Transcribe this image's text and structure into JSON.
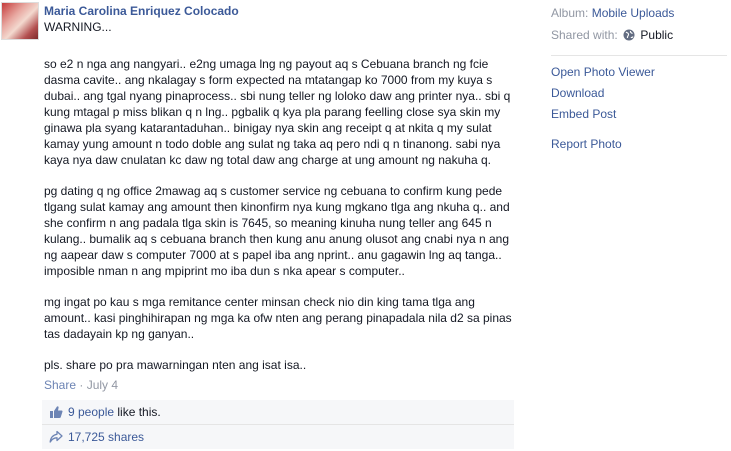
{
  "post": {
    "author": "Maria Carolina Enriquez Colocado",
    "headline": "WARNING...",
    "paragraphs": [
      "so e2 n nga ang nangyari.. e2ng umaga lng ng payout aq s Cebuana branch ng fcie dasma cavite.. ang nkalagay s form expected na mtatangap ko 7000 from my kuya s dubai.. ang tgal nyang pinaprocess.. sbi nung teller ng loloko daw ang printer nya.. sbi q kung mtagal p miss blikan q n lng.. pgbalik q kya pla parang feelling close sya skin my ginawa pla syang katarantaduhan.. binigay nya skin ang receipt q at nkita q my sulat kamay yung amount n todo doble ang sulat ng taka aq pero ndi q n tinanong. sabi nya kaya nya daw cnulatan kc daw ng total daw ang charge at ung amount ng nakuha q.",
      "pg dating q ng office 2mawag aq s customer service ng cebuana to confirm kung pede tlgang sulat kamay ang amount then kinonfirm nya kung mgkano tlga ang nkuha q.. and she confirm n ang padala tlga skin is 7645, so meaning kinuha nung teller ang 645 n kulang.. bumalik aq s cebuana branch then kung anu anung olusot ang cnabi nya n ang ng aapear daw s computer 7000 at s papel iba ang nprint.. anu gagawin lng aq tanga.. imposible nman n ang mpiprint mo iba dun s nka apear s computer..",
      "mg ingat po kau s mga remitance center minsan check nio din king tama tlga ang amount.. kasi pinghihirapan ng mga ka ofw nten ang perang pinapadala nila d2 sa pinas tas dadayain kp ng ganyan..",
      "pls. share po pra mawarningan nten ang isat isa.."
    ],
    "share_label": "Share",
    "separator": "·",
    "date": "July 4"
  },
  "ufi": {
    "likes_count": "9 people",
    "likes_suffix": " like this.",
    "shares": "17,725 shares"
  },
  "sidebar": {
    "album_label": "Album:",
    "album_value": "Mobile Uploads",
    "shared_label": "Shared with:",
    "shared_value": "Public",
    "actions": [
      "Open Photo Viewer",
      "Download",
      "Embed Post",
      "Report Photo"
    ]
  },
  "icons": {
    "avatar": "profile-photo",
    "like": "thumbs-up-icon",
    "share": "share-arrow-icon",
    "privacy": "globe-icon"
  },
  "colors": {
    "link": "#3b5998",
    "muted": "#9197a3",
    "ufi_bg": "#f6f7f9",
    "text": "#141823"
  }
}
